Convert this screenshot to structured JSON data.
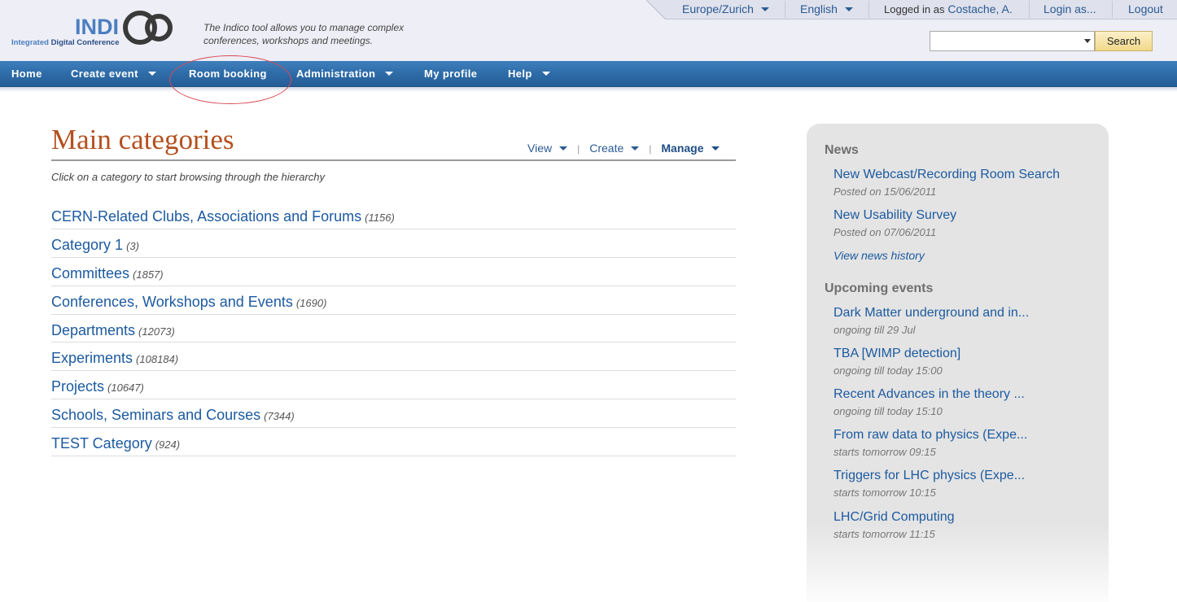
{
  "header": {
    "logo": {
      "wordmark": "INDICO",
      "subtitle_part1": "Integrated ",
      "subtitle_part2": "Digital Conference"
    },
    "tagline": "The Indico tool allows you to manage complex conferences, workshops and meetings.",
    "timezone": "Europe/Zurich",
    "language": "English",
    "logged_in_label": "Logged in as",
    "user_name": "Costache, A.",
    "login_as": "Login as...",
    "logout": "Logout",
    "search_placeholder": "",
    "search_button": "Search"
  },
  "nav": {
    "items": [
      {
        "label": "Home",
        "dropdown": false
      },
      {
        "label": "Create event",
        "dropdown": true
      },
      {
        "label": "Room booking",
        "dropdown": false
      },
      {
        "label": "Administration",
        "dropdown": true
      },
      {
        "label": "My profile",
        "dropdown": false
      },
      {
        "label": "Help",
        "dropdown": true
      }
    ],
    "highlighted": "Room booking"
  },
  "main": {
    "title": "Main categories",
    "actions": {
      "view": "View",
      "create": "Create",
      "manage": "Manage"
    },
    "subtitle": "Click on a category to start browsing through the hierarchy",
    "categories": [
      {
        "name": "CERN-Related Clubs, Associations and Forums",
        "count": "(1156)"
      },
      {
        "name": "Category 1",
        "count": "(3)"
      },
      {
        "name": "Committees",
        "count": "(1857)"
      },
      {
        "name": "Conferences, Workshops and Events",
        "count": "(1690)"
      },
      {
        "name": "Departments",
        "count": "(12073)"
      },
      {
        "name": "Experiments",
        "count": "(108184)"
      },
      {
        "name": "Projects",
        "count": "(10647)"
      },
      {
        "name": "Schools, Seminars and Courses",
        "count": "(7344)"
      },
      {
        "name": "TEST Category",
        "count": "(924)"
      }
    ]
  },
  "side": {
    "news_heading": "News",
    "news": [
      {
        "title": "New Webcast/Recording Room Search",
        "meta": "Posted on 15/06/2011"
      },
      {
        "title": "New Usability Survey",
        "meta": "Posted on 07/06/2011"
      }
    ],
    "view_history": "View news history",
    "upcoming_heading": "Upcoming events",
    "events": [
      {
        "title": "Dark Matter underground and in...",
        "meta": "ongoing till 29 Jul"
      },
      {
        "title": "TBA [WIMP detection]",
        "meta": "ongoing till today 15:00"
      },
      {
        "title": "Recent Advances in the theory ...",
        "meta": "ongoing till today 15:10"
      },
      {
        "title": "From raw data to physics (Expe...",
        "meta": "starts tomorrow 09:15"
      },
      {
        "title": "Triggers for LHC physics (Expe...",
        "meta": "starts tomorrow 10:15"
      },
      {
        "title": "LHC/Grid Computing",
        "meta": "starts tomorrow 11:15"
      }
    ]
  },
  "colors": {
    "nav_blue": "#2d6aa6",
    "link_blue": "#1c5aa0",
    "title_orange": "#b4501f",
    "highlight_red": "#d94a55"
  }
}
